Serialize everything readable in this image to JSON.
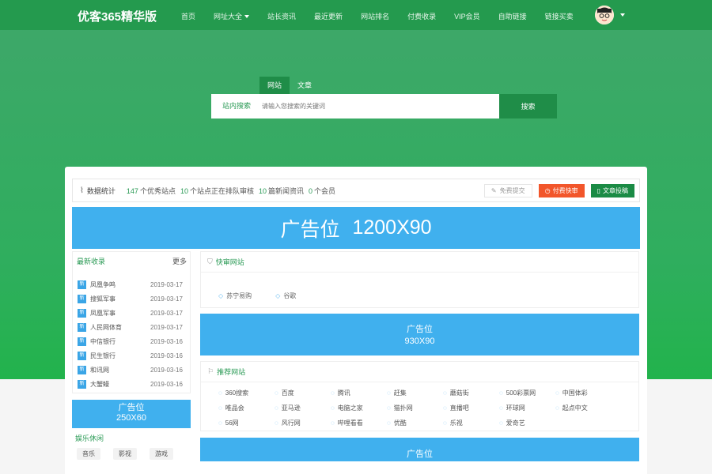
{
  "header": {
    "logo": "优客365精华版",
    "nav": [
      {
        "label": "首页"
      },
      {
        "label": "网址大全",
        "dropdown": true
      },
      {
        "label": "站长资讯"
      },
      {
        "label": "最近更新"
      },
      {
        "label": "网站排名"
      },
      {
        "label": "付费收录"
      },
      {
        "label": "VIP会员"
      },
      {
        "label": "自助链接"
      },
      {
        "label": "链接买卖"
      }
    ]
  },
  "search": {
    "tabs": [
      "网站",
      "文章"
    ],
    "label": "站内搜索",
    "placeholder": "请输入您搜索的关键词",
    "button": "搜索"
  },
  "stats": {
    "title": "数据统计",
    "items": [
      {
        "num": "147",
        "text": "个优秀站点"
      },
      {
        "num": "10",
        "text": "个站点正在排队审核"
      },
      {
        "num": "10",
        "text": "篇新闻资讯"
      },
      {
        "num": "0",
        "text": "个会员"
      }
    ],
    "buttons": [
      "免费提交",
      "付费快审",
      "文章投稿"
    ]
  },
  "ads": {
    "big": [
      "广告位",
      "1200X90"
    ],
    "mid": [
      "广告位",
      "930X90"
    ],
    "small": [
      "广告位",
      "250X60"
    ],
    "bottom": "广告位"
  },
  "latest": {
    "title": "最新收录",
    "more": "更多",
    "badge": "新",
    "items": [
      {
        "title": "凤凰争鸣",
        "date": "2019-03-17"
      },
      {
        "title": "搜狐军事",
        "date": "2019-03-17"
      },
      {
        "title": "凤凰军事",
        "date": "2019-03-17"
      },
      {
        "title": "人民网体育",
        "date": "2019-03-17"
      },
      {
        "title": "中信银行",
        "date": "2019-03-16"
      },
      {
        "title": "民生银行",
        "date": "2019-03-16"
      },
      {
        "title": "和讯网",
        "date": "2019-03-16"
      },
      {
        "title": "大蟹鳗",
        "date": "2019-03-16"
      }
    ]
  },
  "category": {
    "title": "娱乐休闲",
    "tags": [
      "音乐",
      "影视",
      "游戏"
    ]
  },
  "quick": {
    "title": "快审网站",
    "links": [
      "苏宁易购",
      "谷歌"
    ]
  },
  "recommend": {
    "title": "推荐网站",
    "sites": [
      "360搜索",
      "百度",
      "腾讯",
      "赶集",
      "蘑菇街",
      "500彩票网",
      "中国体彩",
      "唯品会",
      "亚马逊",
      "电脑之家",
      "猫扑网",
      "直播吧",
      "环球网",
      "起点中文",
      "56网",
      "风行网",
      "哔哩看看",
      "优酷",
      "乐视",
      "爱奇艺"
    ]
  },
  "colors": {
    "brand_green": "#249a4e",
    "ad_blue": "#40b0ee",
    "orange": "#f2562b"
  }
}
